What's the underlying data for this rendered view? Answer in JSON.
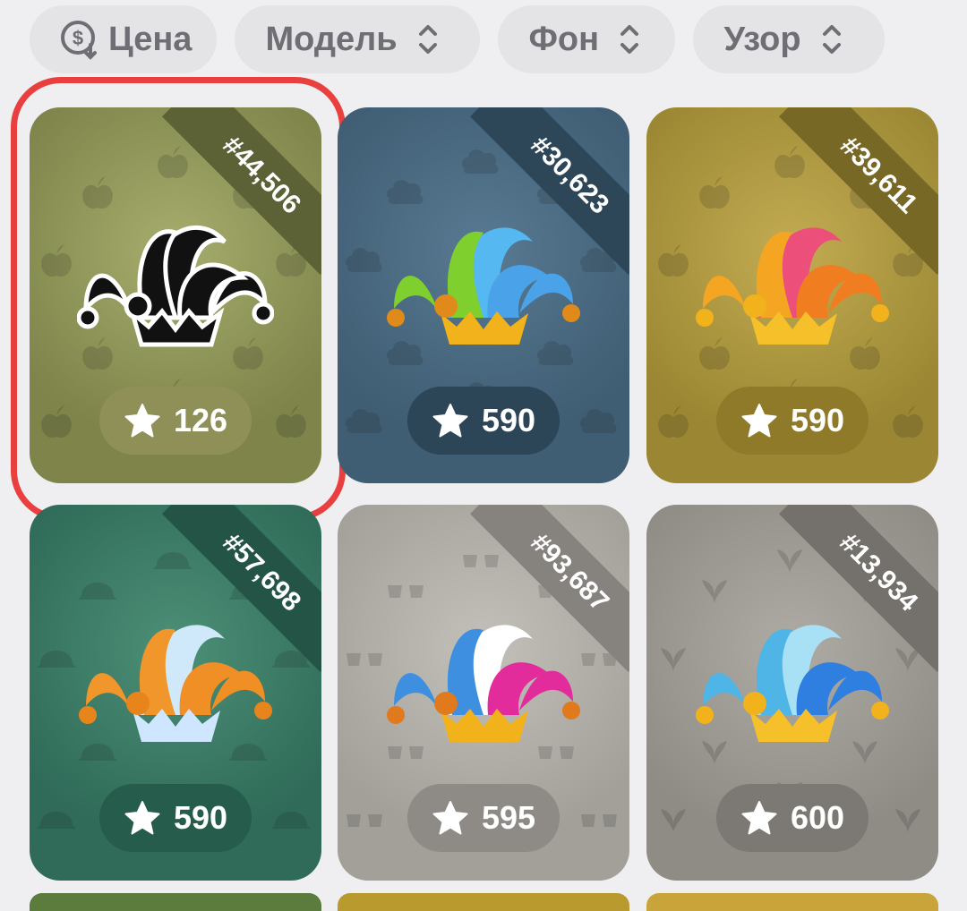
{
  "filters": {
    "price_label": "Цена",
    "model_label": "Модель",
    "background_label": "Фон",
    "pattern_label": "Узор"
  },
  "cards": [
    {
      "number": "#44,506",
      "price": "126",
      "bg": "#7e844a",
      "bg_light": "#a6ad6d",
      "ribbon": "#5c6235",
      "pill": "#8e9057",
      "hat_style": "black",
      "pattern": "apple",
      "selected": true
    },
    {
      "number": "#30,623",
      "price": "590",
      "bg": "#3f5d73",
      "bg_light": "#587a92",
      "ribbon": "#2d4759",
      "pill": "#2c4557",
      "hat_style": "green-blue",
      "pattern": "cloud",
      "selected": false
    },
    {
      "number": "#39,611",
      "price": "590",
      "bg": "#9b8733",
      "bg_light": "#c2ab52",
      "ribbon": "#786826",
      "pill": "#8e7a29",
      "hat_style": "pink-orange",
      "pattern": "apple",
      "selected": false
    },
    {
      "number": "#57,698",
      "price": "590",
      "bg": "#2f6b58",
      "bg_light": "#4d8f77",
      "ribbon": "#245446",
      "pill": "#265c4b",
      "hat_style": "orange-white",
      "pattern": "hat",
      "selected": false
    },
    {
      "number": "#93,687",
      "price": "595",
      "bg": "#a3a09a",
      "bg_light": "#c3c0ba",
      "ribbon": "#86837e",
      "pill": "#8e8b86",
      "hat_style": "blue-pink",
      "pattern": "glasses",
      "selected": false
    },
    {
      "number": "#13,934",
      "price": "600",
      "bg": "#8f8c86",
      "bg_light": "#aeaba5",
      "ribbon": "#74716c",
      "pill": "#7c7974",
      "hat_style": "blue",
      "pattern": "sprout",
      "selected": false
    }
  ]
}
